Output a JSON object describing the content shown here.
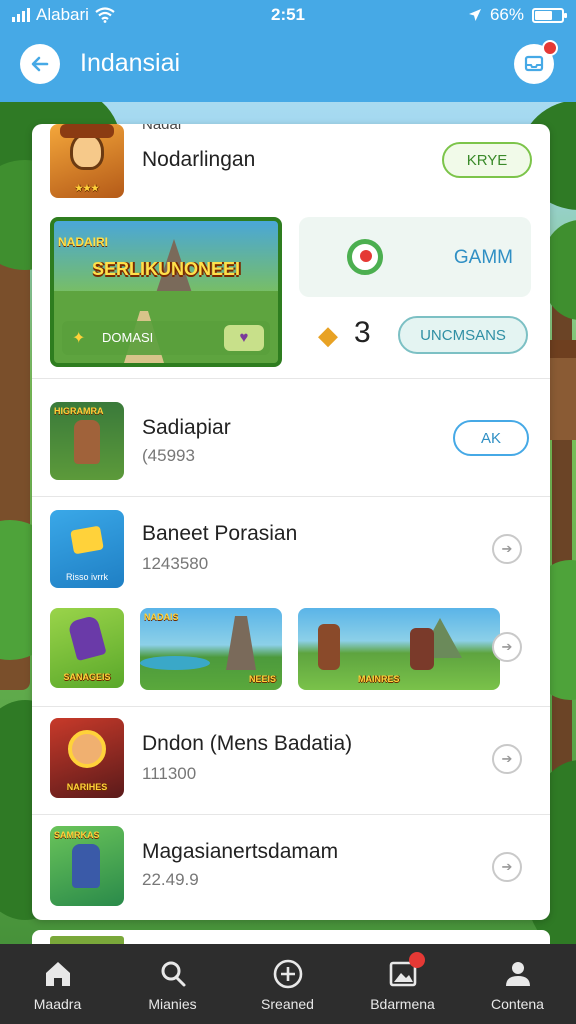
{
  "status_bar": {
    "carrier": "Alabari",
    "time": "2:51",
    "battery": "66%",
    "battery_level": 0.66
  },
  "header": {
    "title": "Indansiai"
  },
  "featured": {
    "game_title_partial": "Nadai",
    "game_title": "Nodarlingan",
    "action_label": "KRYE",
    "banner_caption": "SERLIKUNONEEI",
    "banner_cta": "DOMASI",
    "side_label": "GAMM",
    "count": "3",
    "side_action": "UNCMSANS"
  },
  "list": [
    {
      "title": "Sadiapiar",
      "subtitle": "(45993",
      "action": "AK",
      "thumb_caption": "HIGRAMRA"
    },
    {
      "title": "Baneet Porasian",
      "subtitle": "1243580",
      "thumb_caption": "Risso ivrrk"
    },
    {
      "title": "Dndon (Mens Badatia)",
      "subtitle": "111300",
      "thumb_caption": "NARIHES"
    },
    {
      "title": "Magasianertsdamam",
      "subtitle": "22.49.9",
      "thumb_caption": "SAMRKAS"
    }
  ],
  "gallery": {
    "caption_1": "SANAGEIS",
    "caption_2": "NEEIS",
    "caption_3": "MAINRES"
  },
  "bottom_nav": [
    {
      "label": "Maadra",
      "icon": "home-icon"
    },
    {
      "label": "Mianies",
      "icon": "search-icon"
    },
    {
      "label": "Sreaned",
      "icon": "add-circle-icon"
    },
    {
      "label": "Bdarmena",
      "icon": "image-icon"
    },
    {
      "label": "Contena",
      "icon": "profile-icon"
    }
  ],
  "colors": {
    "primary": "#46a9e6",
    "accent_green": "#7cc44a",
    "nav_bg": "#2d2d2d",
    "badge": "#e53935"
  }
}
